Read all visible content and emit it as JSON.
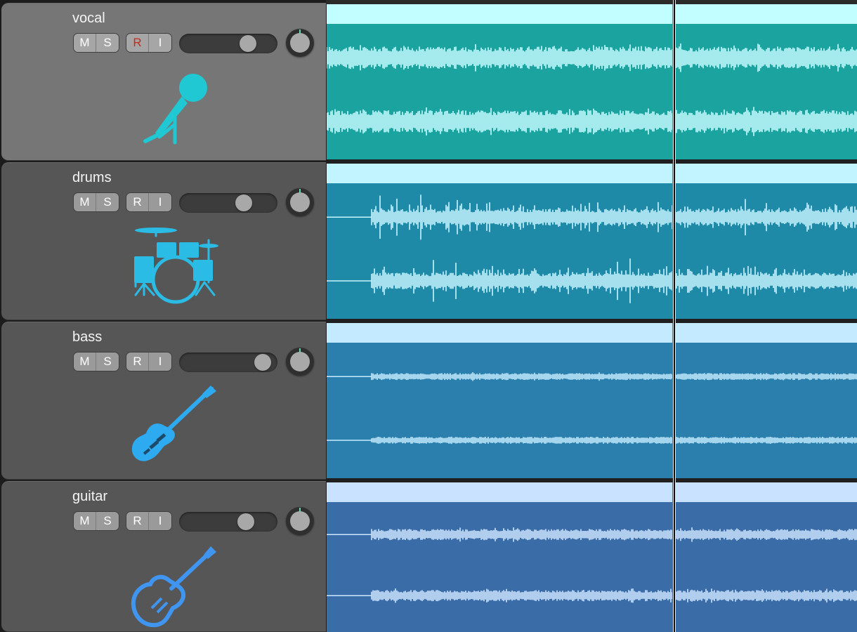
{
  "tracks": [
    {
      "name": "vocal",
      "selected": true,
      "buttons": {
        "mute": "M",
        "solo": "S",
        "record": "R",
        "input": "I"
      },
      "record_armed": true,
      "volume_fraction": 0.75,
      "instrument_icon": "microphone-icon",
      "icon_color": "#1fc8d2",
      "region_title_color": "#c2fdff",
      "region_body_color": "#1ba39f",
      "waveform_color": "#c8fcff"
    },
    {
      "name": "drums",
      "selected": false,
      "buttons": {
        "mute": "M",
        "solo": "S",
        "record": "R",
        "input": "I"
      },
      "record_armed": false,
      "volume_fraction": 0.7,
      "instrument_icon": "drum-kit-icon",
      "icon_color": "#2bbce6",
      "region_title_color": "#c2f4ff",
      "region_body_color": "#1e8aa8",
      "waveform_color": "#c8f6ff"
    },
    {
      "name": "bass",
      "selected": false,
      "buttons": {
        "mute": "M",
        "solo": "S",
        "record": "R",
        "input": "I"
      },
      "record_armed": false,
      "volume_fraction": 0.94,
      "instrument_icon": "bass-guitar-icon",
      "icon_color": "#2eaaf0",
      "region_title_color": "#c4eaff",
      "region_body_color": "#2a7fad",
      "waveform_color": "#c6ecff"
    },
    {
      "name": "guitar",
      "selected": false,
      "buttons": {
        "mute": "M",
        "solo": "S",
        "record": "R",
        "input": "I"
      },
      "record_armed": false,
      "volume_fraction": 0.72,
      "instrument_icon": "electric-guitar-icon",
      "icon_color": "#3f95ef",
      "region_title_color": "#c8e2ff",
      "region_body_color": "#3a6ca8",
      "waveform_color": "#cfe6ff"
    }
  ],
  "playhead_fraction": 0.655
}
